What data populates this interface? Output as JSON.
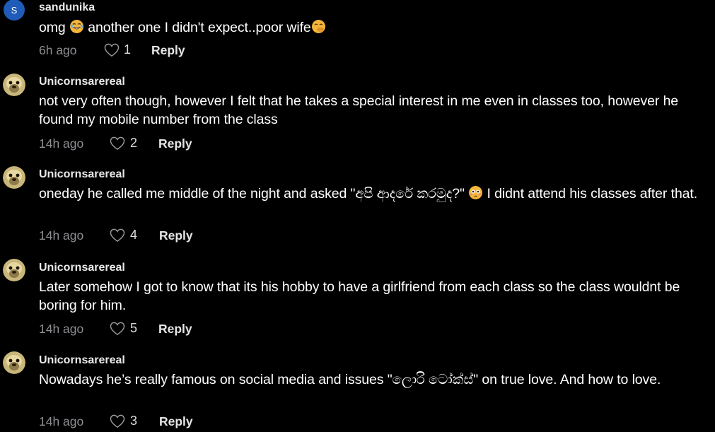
{
  "comments": [
    {
      "avatar_letter": "S",
      "username": "sandunika",
      "text_parts": [
        "omg",
        "another one I didn't expect..poor wife"
      ],
      "time": "6h ago",
      "likes": "1",
      "reply_label": "Reply"
    },
    {
      "username": "Unicornsarereal",
      "text": "not very often though, however I felt that he takes a special interest in me even in classes too, however he found my mobile number from the class",
      "time": "14h ago",
      "likes": "2",
      "reply_label": "Reply"
    },
    {
      "username": "Unicornsarereal",
      "text_parts": [
        "oneday he called me middle of the night and asked \"අපි ආදරේ කරමුද?\"",
        "I didnt attend his classes after that."
      ],
      "time": "14h ago",
      "likes": "4",
      "reply_label": "Reply"
    },
    {
      "username": "Unicornsarereal",
      "text": "Later somehow I got to know that its his hobby to have a girlfriend from each class so the class wouldnt be boring for him.",
      "time": "14h ago",
      "likes": "5",
      "reply_label": "Reply"
    },
    {
      "username": "Unicornsarereal",
      "text": "Nowadays he’s really famous on social media and issues \"ලොරි ටෝක්ස්\" on true love. And how to love.",
      "time": "14h ago",
      "likes": "3",
      "reply_label": "Reply"
    }
  ],
  "emoji_names": [
    "laughing-tears-emoji",
    "hand-over-mouth-emoji",
    "flushed-face-emoji"
  ],
  "colors": {
    "background": "#000000",
    "text": "#ffffff",
    "muted": "#8e8e93",
    "avatar_blue": "#1f5bb8",
    "emoji_yellow": "#f4b53a"
  }
}
